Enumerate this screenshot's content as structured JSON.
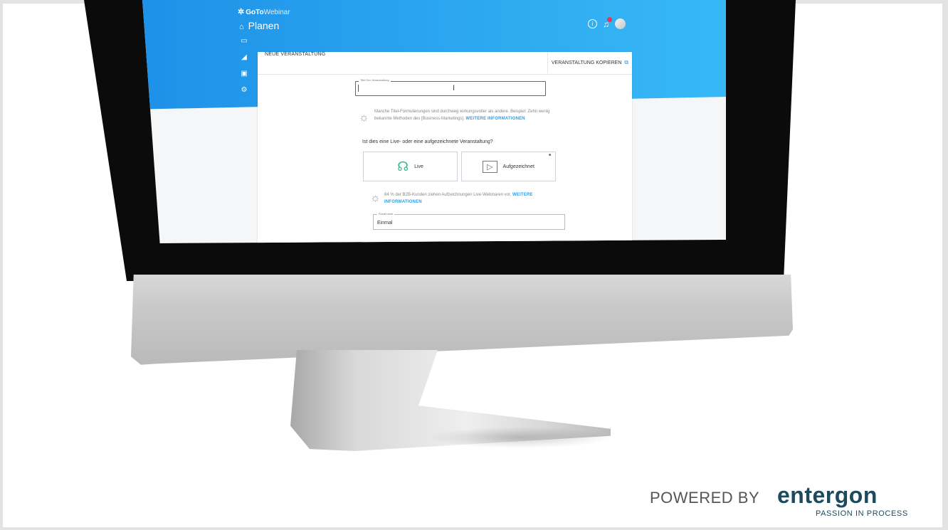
{
  "app": {
    "brand": "GoTo",
    "brand_suffix": "Webinar",
    "page_title": "Planen"
  },
  "panel": {
    "title": "NEUE VERANSTALTUNG",
    "copy_label": "VERANSTALTUNG KOPIEREN",
    "title_field_label": "Titel Der Veranstaltung",
    "title_field_value": "",
    "hint1": "Manche Titel-Formulierungen sind durchweg wirkungsvoller als andere. Beispiel: Zehn wenig bekannte Methoden des [Business-Marketings].",
    "hint1_link": "WEITERE INFORMATIONEN",
    "question": "Ist dies eine Live- oder eine aufgezeichnete Veranstaltung?",
    "option_live": "Live",
    "option_recorded": "Aufgezeichnet",
    "hint2": "84 % der B2B-Kunden ziehen Aufzeichnungen Live-Webinaren vor.",
    "hint2_link": "WEITERE INFORMATIONEN",
    "repeat_field_label": "Findet statt",
    "repeat_field_value": "Einmal"
  },
  "footer": {
    "powered_by": "POWERED BY",
    "logo": "entergon",
    "tagline": "PASSION IN PROCESS"
  },
  "colors": {
    "hero_start": "#1e91e8",
    "hero_end": "#37b9f6",
    "link": "#2b9fe6",
    "notification": "#e8365c",
    "logo": "#1e4a5e"
  },
  "icons": [
    "info-icon",
    "bell-icon",
    "avatar",
    "monitor-icon",
    "chart-icon",
    "contacts-icon",
    "settings-icon",
    "copy-icon",
    "lightbulb-icon",
    "live-icon",
    "video-icon",
    "lock-icon"
  ]
}
